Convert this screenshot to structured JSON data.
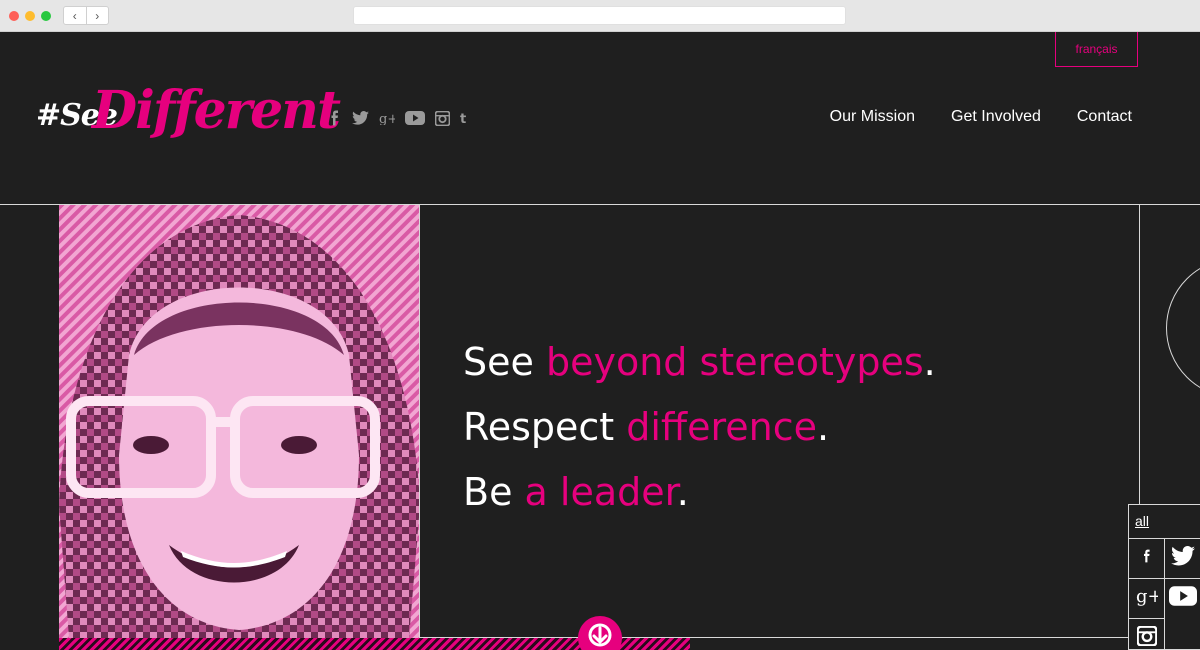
{
  "header": {
    "language_label": "français",
    "logo": {
      "hash_text": "#See",
      "main_text": "Different"
    },
    "social_icons": [
      "facebook-icon",
      "twitter-icon",
      "google-plus-icon",
      "youtube-icon",
      "instagram-icon",
      "tumblr-icon"
    ],
    "nav": [
      {
        "label": "Our Mission"
      },
      {
        "label": "Get Involved"
      },
      {
        "label": "Contact"
      }
    ]
  },
  "hero": {
    "lines": [
      {
        "plain": "See ",
        "accent": "beyond stereotypes",
        "end": "."
      },
      {
        "plain": "Respect ",
        "accent": "difference",
        "end": "."
      },
      {
        "plain": "Be ",
        "accent": "a leader",
        "end": "."
      }
    ],
    "scroll_icon": "arrow-down-icon"
  },
  "share_panel": {
    "all_label": "all",
    "icons": [
      "facebook-icon",
      "twitter-icon",
      "google-plus-icon",
      "youtube-icon",
      "instagram-icon"
    ]
  },
  "colors": {
    "accent": "#e6007e",
    "background": "#1f1f1f",
    "text": "#ffffff",
    "lines": "#d9d9d9"
  }
}
